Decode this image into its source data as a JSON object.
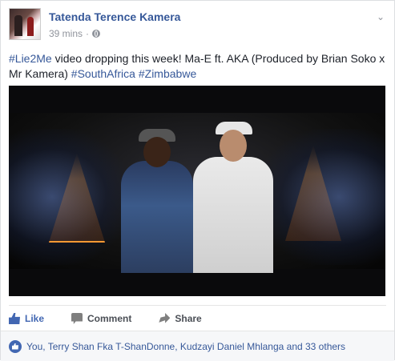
{
  "post": {
    "author": "Tatenda Terence Kamera",
    "time": "39 mins",
    "separator": "·",
    "text_segments": [
      {
        "type": "hashtag",
        "text": "#Lie2Me"
      },
      {
        "type": "plain",
        "text": " video dropping this week! Ma-E ft. AKA (Produced by Brian Soko x Mr Kamera) "
      },
      {
        "type": "hashtag",
        "text": "#SouthAfrica"
      },
      {
        "type": "plain",
        "text": " "
      },
      {
        "type": "hashtag",
        "text": "#Zimbabwe"
      }
    ]
  },
  "actions": {
    "like": "Like",
    "comment": "Comment",
    "share": "Share"
  },
  "likes_summary": "You, Terry Shan Fka T-ShanDonne, Kudzayi Daniel Mhlanga and 33 others",
  "colors": {
    "link": "#365899",
    "like_active": "#4267b2",
    "muted": "#90949c"
  },
  "icons": [
    "globe-icon",
    "chevron-down-icon",
    "like-icon",
    "comment-icon",
    "share-icon",
    "like-reaction-icon"
  ]
}
